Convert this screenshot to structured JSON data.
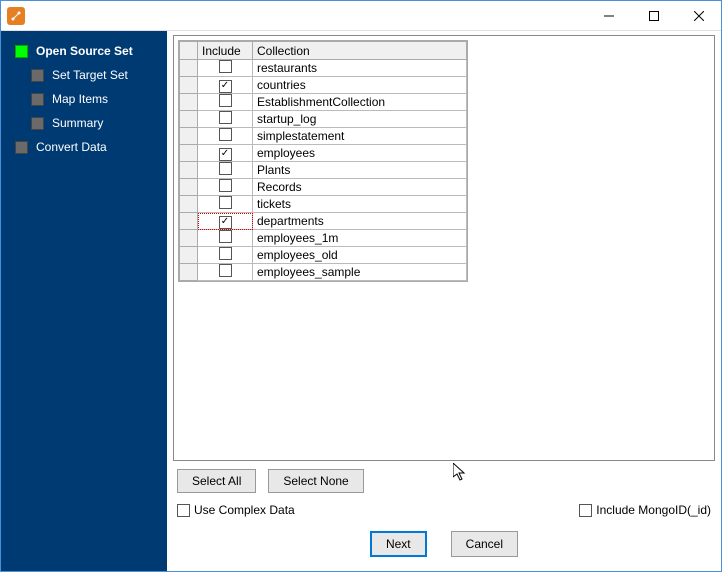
{
  "titlebar": {
    "app_icon_name": "app-icon"
  },
  "nav": {
    "items": [
      {
        "label": "Open Source Set",
        "active": true,
        "child": false
      },
      {
        "label": "Set Target Set",
        "active": false,
        "child": true
      },
      {
        "label": "Map Items",
        "active": false,
        "child": true
      },
      {
        "label": "Summary",
        "active": false,
        "child": true
      },
      {
        "label": "Convert Data",
        "active": false,
        "child": false
      }
    ]
  },
  "table": {
    "headers": {
      "include": "Include",
      "collection": "Collection"
    },
    "rows": [
      {
        "include": false,
        "collection": "restaurants",
        "highlight": false
      },
      {
        "include": true,
        "collection": "countries",
        "highlight": false
      },
      {
        "include": false,
        "collection": "EstablishmentCollection",
        "highlight": false
      },
      {
        "include": false,
        "collection": "startup_log",
        "highlight": false
      },
      {
        "include": false,
        "collection": "simplestatement",
        "highlight": false
      },
      {
        "include": true,
        "collection": "employees",
        "highlight": false
      },
      {
        "include": false,
        "collection": "Plants",
        "highlight": false
      },
      {
        "include": false,
        "collection": "Records",
        "highlight": false
      },
      {
        "include": false,
        "collection": "tickets",
        "highlight": false
      },
      {
        "include": true,
        "collection": "departments",
        "highlight": true
      },
      {
        "include": false,
        "collection": "employees_1m",
        "highlight": false
      },
      {
        "include": false,
        "collection": "employees_old",
        "highlight": false
      },
      {
        "include": false,
        "collection": "employees_sample",
        "highlight": false
      }
    ]
  },
  "buttons": {
    "select_all": "Select All",
    "select_none": "Select None",
    "next": "Next",
    "cancel": "Cancel"
  },
  "options": {
    "use_complex": {
      "label": "Use Complex Data",
      "checked": false
    },
    "include_mongoid": {
      "label": "Include MongoID(_id)",
      "checked": false
    }
  }
}
